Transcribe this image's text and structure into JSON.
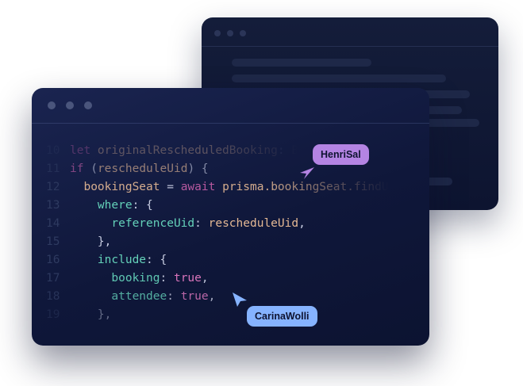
{
  "code_lines": [
    {
      "num": "10",
      "parts": [
        {
          "t": "let ",
          "c": "kw"
        },
        {
          "t": "originalRescheduledBooking",
          "c": "var"
        },
        {
          "t": ": ",
          "c": "punc"
        },
        {
          "t": "B",
          "c": "var"
        }
      ]
    },
    {
      "num": "11",
      "parts": [
        {
          "t": "if ",
          "c": "kw"
        },
        {
          "t": "(",
          "c": "punc"
        },
        {
          "t": "rescheduleUid",
          "c": "var"
        },
        {
          "t": ") {",
          "c": "punc"
        }
      ]
    },
    {
      "num": "12",
      "parts": [
        {
          "t": "  bookingSeat",
          "c": "var"
        },
        {
          "t": " = ",
          "c": "punc"
        },
        {
          "t": "await ",
          "c": "kw"
        },
        {
          "t": "prisma.bookingSeat.findU",
          "c": "fn"
        }
      ]
    },
    {
      "num": "13",
      "parts": [
        {
          "t": "    where",
          "c": "prop"
        },
        {
          "t": ": {",
          "c": "punc"
        }
      ]
    },
    {
      "num": "14",
      "parts": [
        {
          "t": "      referenceUid",
          "c": "prop"
        },
        {
          "t": ": ",
          "c": "punc"
        },
        {
          "t": "rescheduleUid",
          "c": "var"
        },
        {
          "t": ",",
          "c": "punc"
        }
      ]
    },
    {
      "num": "15",
      "parts": [
        {
          "t": "    },",
          "c": "punc"
        }
      ]
    },
    {
      "num": "16",
      "parts": [
        {
          "t": "    include",
          "c": "prop"
        },
        {
          "t": ": {",
          "c": "punc"
        }
      ]
    },
    {
      "num": "17",
      "parts": [
        {
          "t": "      booking",
          "c": "prop"
        },
        {
          "t": ": ",
          "c": "punc"
        },
        {
          "t": "true",
          "c": "val"
        },
        {
          "t": ",",
          "c": "punc"
        }
      ]
    },
    {
      "num": "18",
      "parts": [
        {
          "t": "      attendee",
          "c": "prop"
        },
        {
          "t": ": ",
          "c": "punc"
        },
        {
          "t": "true",
          "c": "val"
        },
        {
          "t": ",",
          "c": "punc"
        }
      ]
    },
    {
      "num": "19",
      "parts": [
        {
          "t": "    },",
          "c": "punc"
        }
      ]
    }
  ],
  "collaborators": {
    "henri": {
      "name": "HenriSal",
      "color": "#b484e3"
    },
    "carina": {
      "name": "CarinaWolli",
      "color": "#86b3ff"
    }
  },
  "icons": {
    "cursor": "pointer-arrow-icon",
    "window_dot": "window-control-dot-icon"
  }
}
